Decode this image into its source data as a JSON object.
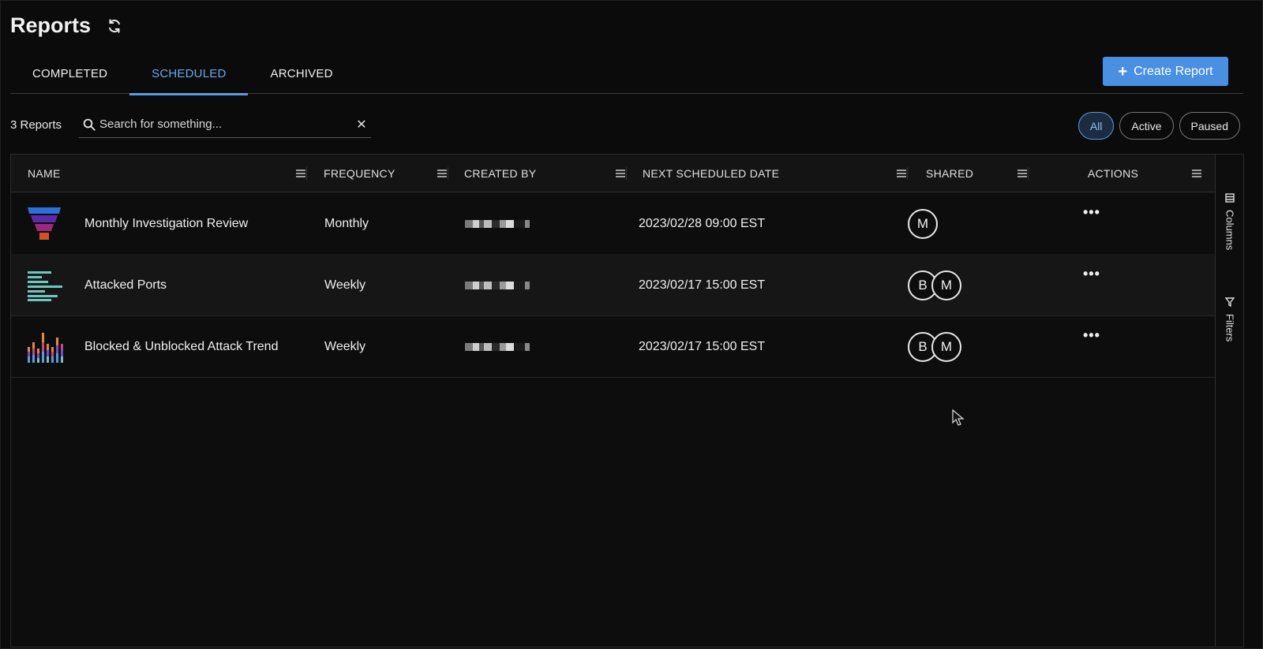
{
  "page": {
    "title": "Reports"
  },
  "tabs": [
    {
      "label": "COMPLETED",
      "active": false
    },
    {
      "label": "SCHEDULED",
      "active": true
    },
    {
      "label": "ARCHIVED",
      "active": false
    }
  ],
  "toolbar": {
    "create_label": "Create Report",
    "count_label": "3 Reports"
  },
  "search": {
    "placeholder": "Search for something...",
    "clear_glyph": "✕"
  },
  "filters": [
    {
      "label": "All",
      "active": true
    },
    {
      "label": "Active",
      "active": false
    },
    {
      "label": "Paused",
      "active": false
    }
  ],
  "table": {
    "columns": [
      "NAME",
      "FREQUENCY",
      "CREATED BY",
      "NEXT SCHEDULED DATE",
      "SHARED",
      "ACTIONS"
    ],
    "rows": [
      {
        "icon": "funnel-chart-icon",
        "name": "Monthly Investigation Review",
        "frequency": "Monthly",
        "created_by": "redacted",
        "next_date": "2023/02/28 09:00 EST",
        "shared": [
          "M"
        ]
      },
      {
        "icon": "horizontal-bar-chart-icon",
        "name": "Attacked Ports",
        "frequency": "Weekly",
        "created_by": "redacted",
        "next_date": "2023/02/17 15:00 EST",
        "shared": [
          "B",
          "M"
        ]
      },
      {
        "icon": "stacked-bar-chart-icon",
        "name": "Blocked & Unblocked Attack Trend",
        "frequency": "Weekly",
        "created_by": "redacted",
        "next_date": "2023/02/17 15:00 EST",
        "shared": [
          "B",
          "M"
        ]
      }
    ],
    "actions_glyph": "•••"
  },
  "side_panel": {
    "columns_label": "Columns",
    "filters_label": "Filters"
  },
  "colors": {
    "accent": "#4a90e2",
    "tab_active": "#6aa8ea",
    "background": "#0b0b0b"
  }
}
